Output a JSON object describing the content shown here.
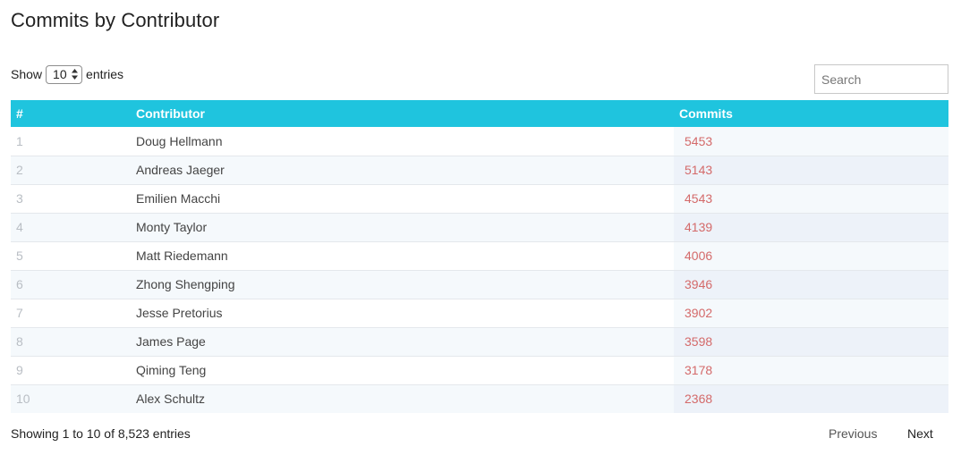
{
  "page": {
    "title": "Commits by Contributor"
  },
  "length_control": {
    "prefix": "Show",
    "selected": "10",
    "suffix": "entries"
  },
  "search": {
    "placeholder": "Search",
    "value": ""
  },
  "table": {
    "headers": {
      "rank": "#",
      "contributor": "Contributor",
      "commits": "Commits"
    },
    "rows": [
      {
        "rank": "1",
        "contributor": "Doug Hellmann",
        "commits": "5453"
      },
      {
        "rank": "2",
        "contributor": "Andreas Jaeger",
        "commits": "5143"
      },
      {
        "rank": "3",
        "contributor": "Emilien Macchi",
        "commits": "4543"
      },
      {
        "rank": "4",
        "contributor": "Monty Taylor",
        "commits": "4139"
      },
      {
        "rank": "5",
        "contributor": "Matt Riedemann",
        "commits": "4006"
      },
      {
        "rank": "6",
        "contributor": "Zhong Shengping",
        "commits": "3946"
      },
      {
        "rank": "7",
        "contributor": "Jesse Pretorius",
        "commits": "3902"
      },
      {
        "rank": "8",
        "contributor": "James Page",
        "commits": "3598"
      },
      {
        "rank": "9",
        "contributor": "Qiming Teng",
        "commits": "3178"
      },
      {
        "rank": "10",
        "contributor": "Alex Schultz",
        "commits": "2368"
      }
    ]
  },
  "info": {
    "text": "Showing 1 to 10 of 8,523 entries"
  },
  "pagination": {
    "previous": "Previous",
    "next": "Next"
  },
  "colors": {
    "header_bg": "#1fc4de",
    "commits_text": "#d46a6a",
    "rank_text": "#b9bec4"
  }
}
